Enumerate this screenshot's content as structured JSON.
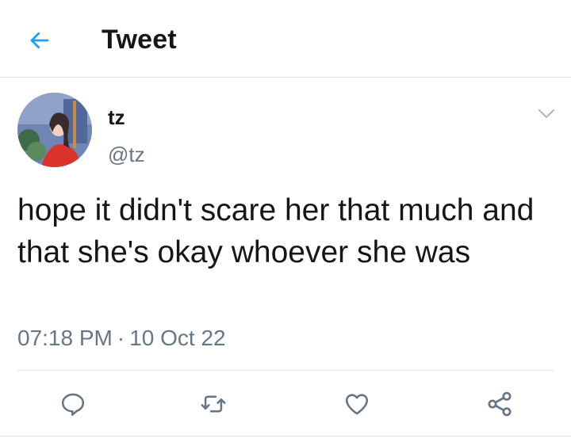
{
  "header": {
    "title": "Tweet"
  },
  "tweet": {
    "author_name": "tz",
    "author_handle": "@tz",
    "text": "hope it didn't scare her that much and that she's okay whoever she was",
    "time": "07:18 PM",
    "date": "10 Oct 22",
    "separator": "·"
  },
  "icons": {
    "back": "arrow-left-icon",
    "more": "chevron-down-icon",
    "reply": "reply-icon",
    "retweet": "retweet-icon",
    "like": "heart-icon",
    "share": "share-icon"
  },
  "colors": {
    "accent": "#1da1f2",
    "secondary_text": "#657786",
    "icon_gray": "#657786",
    "divider": "#dfe3e6"
  }
}
